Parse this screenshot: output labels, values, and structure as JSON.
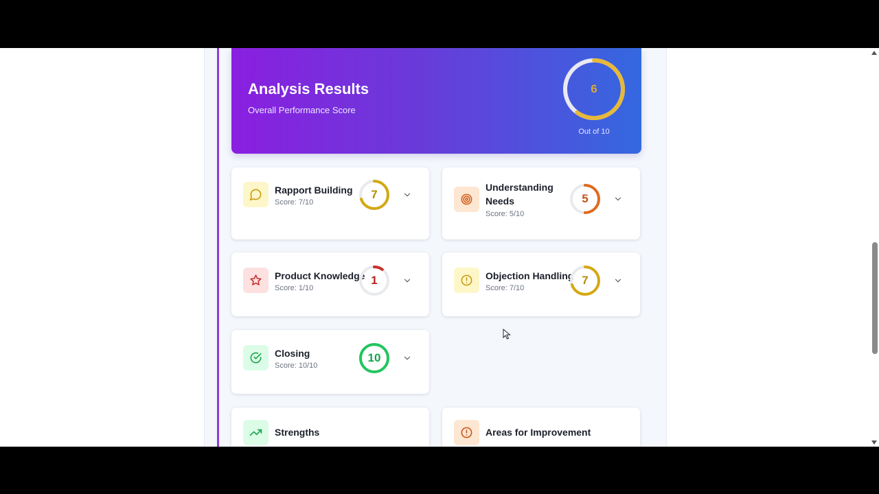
{
  "hero": {
    "title": "Analysis Results",
    "subtitle": "Overall Performance Score",
    "score": 6,
    "max": 10,
    "caption": "Out of 10",
    "gauge_color": "#e6b93a"
  },
  "categories": [
    {
      "title": "Rapport Building",
      "score_text": "Score: 7/10",
      "score": 7,
      "max": 10,
      "color": "#d4a812",
      "icon": "chat-bubble-icon",
      "icon_bg": "#fdf6c8"
    },
    {
      "title": "Understanding Needs",
      "score_text": "Score: 5/10",
      "score": 5,
      "max": 10,
      "color": "#e06a1f",
      "icon": "target-icon",
      "icon_bg": "#fde6d2"
    },
    {
      "title": "Product Knowledge",
      "score_text": "Score: 1/10",
      "score": 1,
      "max": 10,
      "color": "#c9302c",
      "icon": "star-icon",
      "icon_bg": "#fde0e0"
    },
    {
      "title": "Objection Handling",
      "score_text": "Score: 7/10",
      "score": 7,
      "max": 10,
      "color": "#d4a812",
      "icon": "alert-circle-icon",
      "icon_bg": "#fdf6c8"
    },
    {
      "title": "Closing",
      "score_text": "Score: 10/10",
      "score": 10,
      "max": 10,
      "color": "#22c55e",
      "icon": "check-circle-icon",
      "icon_bg": "#dcfce7"
    }
  ],
  "sections": [
    {
      "title": "Strengths",
      "icon": "trending-up-icon",
      "icon_bg": "#dcfce7",
      "color": "#16a34a"
    },
    {
      "title": "Areas for Improvement",
      "icon": "alert-circle-icon",
      "icon_bg": "#fde6d2",
      "color": "#c2571a"
    }
  ]
}
